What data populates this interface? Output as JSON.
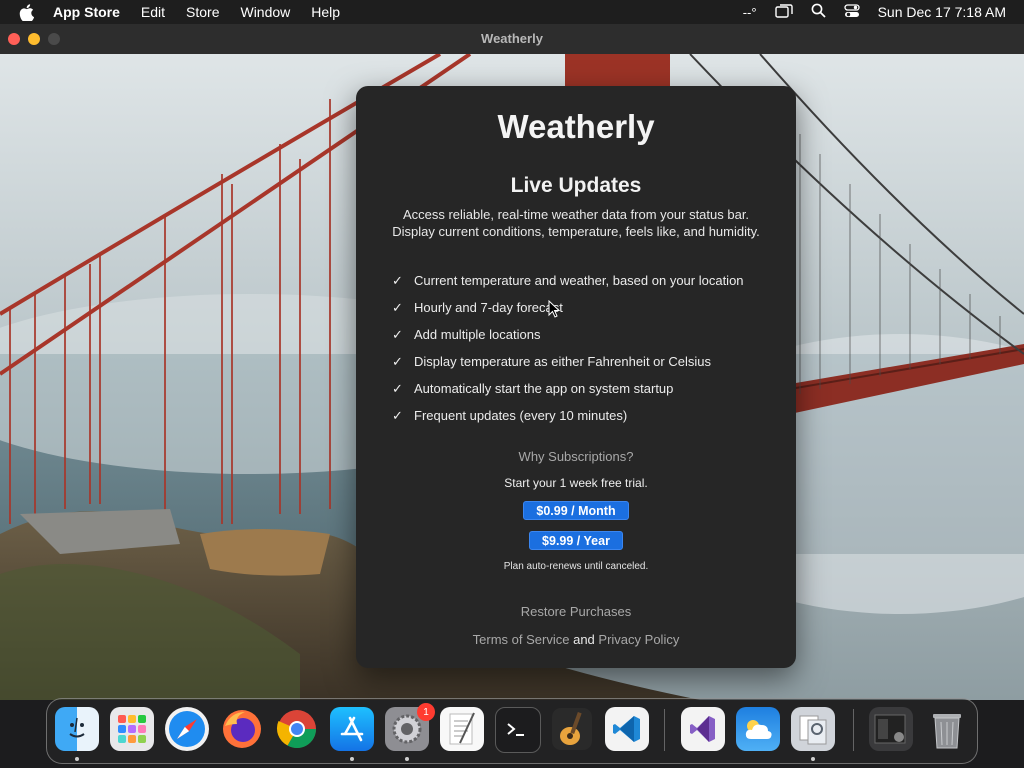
{
  "menubar": {
    "app": "App Store",
    "items": [
      "Edit",
      "Store",
      "Window",
      "Help"
    ],
    "status_text": "--°",
    "clock": "Sun Dec 17  7:18 AM"
  },
  "window": {
    "title": "Weatherly"
  },
  "panel": {
    "app_name": "Weatherly",
    "feature_title": "Live Updates",
    "description_line1": "Access reliable, real-time weather data from your status bar.",
    "description_line2": "Display current conditions, temperature, feels like, and humidity.",
    "features": [
      "Current temperature and weather, based on your location",
      "Hourly and 7-day forecast",
      "Add multiple locations",
      "Display temperature as either Fahrenheit or Celsius",
      "Automatically start the app on system startup",
      "Frequent updates (every 10 minutes)"
    ],
    "why_subscriptions": "Why Subscriptions?",
    "trial_text": "Start your 1 week free trial.",
    "monthly_price": "$0.99 / Month",
    "yearly_price": "$9.99 / Year",
    "auto_renew": "Plan auto-renews until canceled.",
    "restore": "Restore Purchases",
    "terms": "Terms of Service",
    "and": "and",
    "privacy": "Privacy Policy"
  },
  "dock": {
    "apps": [
      "finder-icon",
      "launchpad-icon",
      "safari-icon",
      "firefox-icon",
      "chrome-icon",
      "app-store-icon",
      "system-settings-icon",
      "textedit-icon",
      "terminal-icon",
      "garageband-icon",
      "vscode-icon",
      "visual-studio-icon",
      "weather-icon",
      "preview-icon",
      "screenshot-stack-icon",
      "trash-icon"
    ],
    "settings_badge": "1"
  },
  "colors": {
    "accent": "#1b6fe0",
    "panel_bg": "#262626",
    "menubar_bg": "#1e1e1e"
  }
}
